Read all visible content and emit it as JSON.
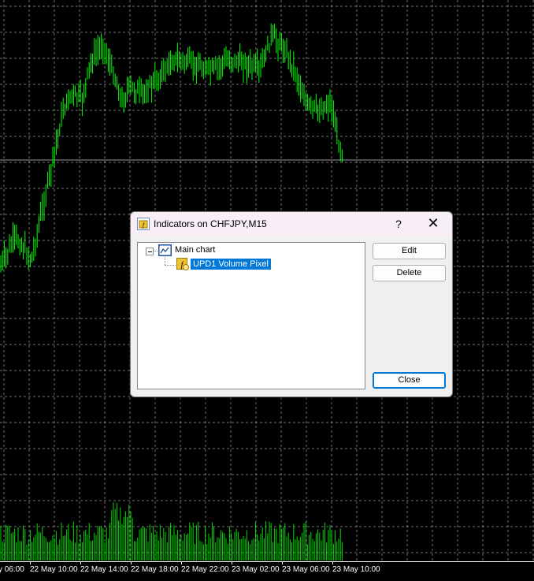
{
  "chart": {
    "symbol": "CHFJPY",
    "timeframe": "M15",
    "background_color": "#000000",
    "candle_color": "#00ff00",
    "volume_color": "#00ff00",
    "grid_color": "#d0d0d0",
    "time_labels": [
      "y 06:00",
      "22 May 10:00",
      "22 May 14:00",
      "22 May 18:00",
      "22 May 22:00",
      "23 May 02:00",
      "23 May 06:00",
      "23 May 10:00"
    ]
  },
  "dialog": {
    "title": "Indicators on CHFJPY,M15",
    "help_label": "?",
    "close_icon": "close-icon",
    "tree": {
      "root_label": "Main chart",
      "items": [
        {
          "label": "UPD1 Volume Pixel",
          "selected": true
        }
      ]
    },
    "buttons": {
      "edit": "Edit",
      "delete": "Delete",
      "close": "Close"
    }
  }
}
